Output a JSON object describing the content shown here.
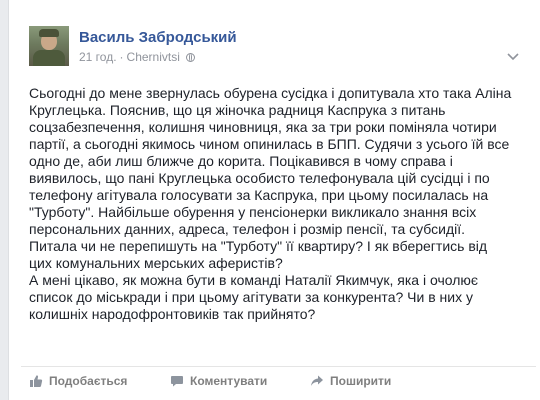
{
  "post": {
    "author": "Василь Забродський",
    "time": "21 год.",
    "separator": "·",
    "location": "Chernivtsi",
    "lines": [
      "Сьогодні до мене звернулась обурена сусідка і допитувала хто така Аліна",
      "Круглецька. Пояснив, що ця жіночка радниця Каспрука з питань",
      "соцзабезпечення, колишня чиновниця, яка за три роки поміняла чотири",
      "партії, а сьогодні якимось чином опинилась в БПП. Судячи з усього їй все",
      "одно де, аби лиш ближче до корита. Поцікавився в чому справа і",
      "виявилось, що пані Круглецька особисто телефонувала цій сусідці і по",
      "телефону агітувала голосувати за Каспрука, при цьому посилалась на",
      "\"Турботу\". Найбільше обурення у пенсіонерки викликало знання всіх",
      "персональних данних, адреса, телефон і розмір пенсії, та субсидії.",
      "Питала чи не перепишуть на \"Турботу\" її квартиру? І як вберегтись від",
      "цих комунальних мерських аферистів?",
      "А мені цікаво, як можна бути в команді Наталії Якимчук, яка і очолює",
      "список до міськради і при цьому агітувати за конкурента? Чи в них у",
      "колишніх народофронтовиків так прийнято?"
    ]
  },
  "actions": {
    "like": "Подобається",
    "comment": "Коментувати",
    "share": "Поширити"
  },
  "icons": {
    "like": "thumbs-up-icon",
    "comment": "speech-bubble-icon",
    "share": "share-arrow-icon",
    "privacy": "globe-icon",
    "menu": "chevron-down-icon"
  },
  "colors": {
    "author": "#365899",
    "meta": "#90949c",
    "text": "#1d2129",
    "action": "#7f7f7f"
  }
}
